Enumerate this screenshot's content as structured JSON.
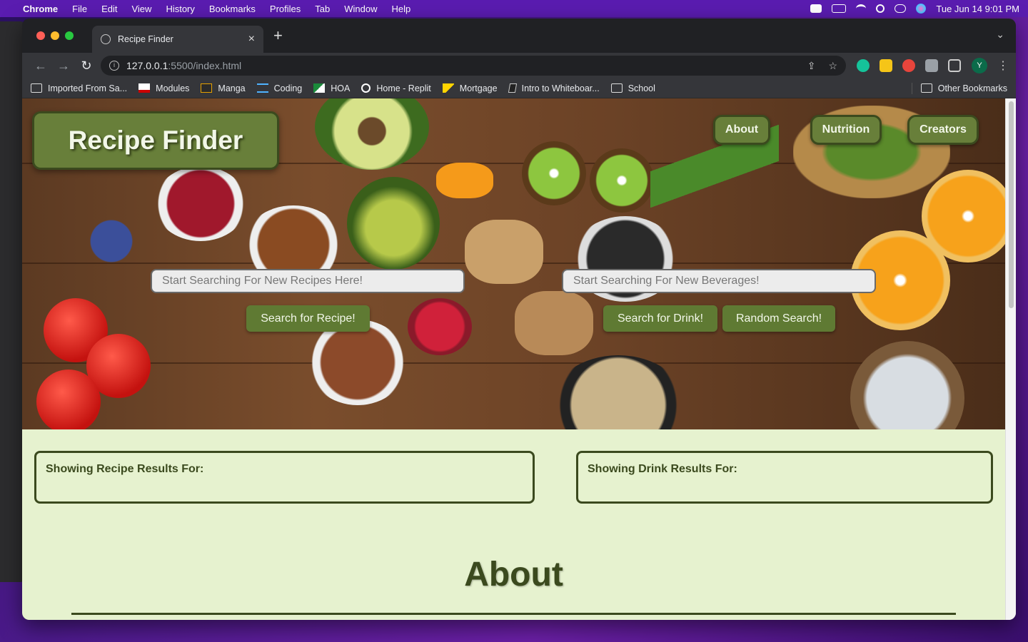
{
  "menubar": {
    "app": "Chrome",
    "items": [
      "File",
      "Edit",
      "View",
      "History",
      "Bookmarks",
      "Profiles",
      "Tab",
      "Window",
      "Help"
    ],
    "datetime": "Tue Jun 14  9:01 PM"
  },
  "browser": {
    "tab_title": "Recipe Finder",
    "url_host": "127.0.0.1",
    "url_path": ":5500/index.html",
    "avatar_letter": "Y",
    "bookmarks": [
      {
        "label": "Imported From Sa...",
        "icon": "folder-icon"
      },
      {
        "label": "Modules",
        "icon": "usa-icon"
      },
      {
        "label": "Manga",
        "icon": "manga-icon"
      },
      {
        "label": "Coding",
        "icon": "coding-icon"
      },
      {
        "label": "HOA",
        "icon": "hoa-icon"
      },
      {
        "label": "Home - Replit",
        "icon": "replit-icon"
      },
      {
        "label": "Mortgage",
        "icon": "mortgage-icon"
      },
      {
        "label": "Intro to Whiteboar...",
        "icon": "whiteboard-icon"
      },
      {
        "label": "School",
        "icon": "folder-icon"
      }
    ],
    "other_bookmarks": "Other Bookmarks"
  },
  "page": {
    "title": "Recipe Finder",
    "nav": {
      "about": "About",
      "nutrition": "Nutrition",
      "creators": "Creators"
    },
    "recipe_search": {
      "placeholder": "Start Searching For New Recipes Here!",
      "button": "Search for Recipe!"
    },
    "drink_search": {
      "placeholder": "Start Searching For New Beverages!",
      "button": "Search for Drink!"
    },
    "random_button": "Random Search!",
    "recipe_results_label": "Showing Recipe Results For:",
    "drink_results_label": "Showing Drink Results For:",
    "about_heading": "About"
  },
  "colors": {
    "accent": "#687f3a",
    "accent_dark": "#3b4a1e",
    "page_bg": "#e6f2cf"
  }
}
